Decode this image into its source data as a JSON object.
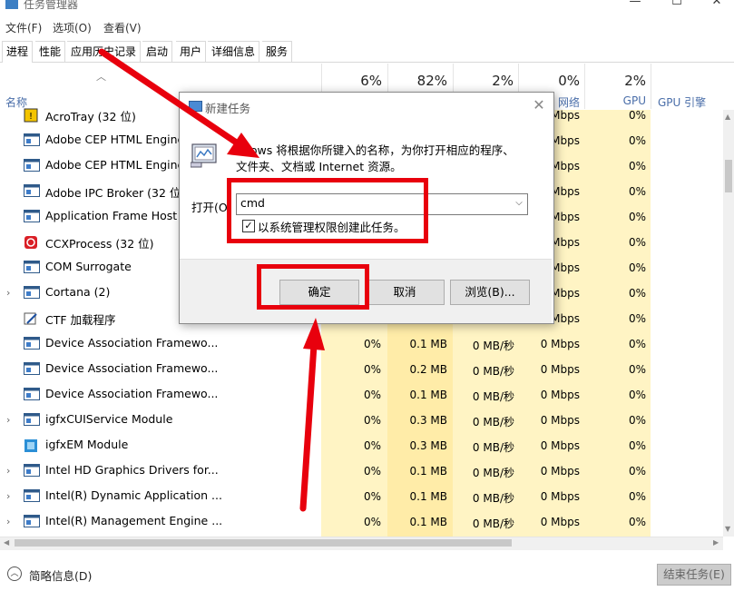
{
  "window": {
    "title": "任务管理器",
    "minimize_glyph": "—",
    "maximize_glyph": "☐",
    "close_glyph": "✕"
  },
  "menu": [
    "文件(F)",
    "选项(O)",
    "查看(V)"
  ],
  "tabs": [
    "进程",
    "性能",
    "应用历史记录",
    "启动",
    "用户",
    "详细信息",
    "服务"
  ],
  "columns": {
    "name": "名称",
    "cpu_pct": "6%",
    "memory_pct": "82%",
    "disk_pct": "2%",
    "network_pct": "0%",
    "network": "网络",
    "gpu_pct": "2%",
    "gpu": "GPU",
    "gpu_engine": "GPU 引擎"
  },
  "rows": [
    {
      "name": "AcroTray (32 位)",
      "expandable": false,
      "icon": "acrotray-icon",
      "cpu": "",
      "mem": "",
      "disk": "",
      "net": "Mbps",
      "gpu": "0%"
    },
    {
      "name": "Adobe CEP HTML Engine",
      "expandable": false,
      "icon": "app-window-icon",
      "cpu": "",
      "mem": "",
      "disk": "",
      "net": "Mbps",
      "gpu": "0%"
    },
    {
      "name": "Adobe CEP HTML Engine",
      "expandable": false,
      "icon": "app-window-icon",
      "cpu": "",
      "mem": "",
      "disk": "",
      "net": "Mbps",
      "gpu": "0%"
    },
    {
      "name": "Adobe IPC Broker (32 位)",
      "expandable": false,
      "icon": "app-window-icon",
      "cpu": "",
      "mem": "",
      "disk": "",
      "net": "Mbps",
      "gpu": "0%"
    },
    {
      "name": "Application Frame Host",
      "expandable": false,
      "icon": "app-window-icon",
      "cpu": "",
      "mem": "",
      "disk": "",
      "net": "Mbps",
      "gpu": "0%"
    },
    {
      "name": "CCXProcess (32 位)",
      "expandable": false,
      "icon": "creative-cloud-icon",
      "cpu": "",
      "mem": "",
      "disk": "",
      "net": "Mbps",
      "gpu": "0%"
    },
    {
      "name": "COM Surrogate",
      "expandable": false,
      "icon": "app-window-icon",
      "cpu": "",
      "mem": "",
      "disk": "",
      "net": "Mbps",
      "gpu": "0%"
    },
    {
      "name": "Cortana (2)",
      "expandable": true,
      "icon": "app-window-icon",
      "cpu": "",
      "mem": "",
      "disk": "",
      "net": "Mbps",
      "gpu": "0%"
    },
    {
      "name": "CTF 加载程序",
      "expandable": false,
      "icon": "ctf-pen-icon",
      "cpu": "",
      "mem": "",
      "disk": "",
      "net": "Mbps",
      "gpu": "0%"
    },
    {
      "name": "Device Association Framewo...",
      "expandable": false,
      "icon": "app-window-icon",
      "cpu": "0%",
      "mem": "0.1 MB",
      "disk": "0 MB/秒",
      "net": "0 Mbps",
      "gpu": "0%"
    },
    {
      "name": "Device Association Framewo...",
      "expandable": false,
      "icon": "app-window-icon",
      "cpu": "0%",
      "mem": "0.2 MB",
      "disk": "0 MB/秒",
      "net": "0 Mbps",
      "gpu": "0%"
    },
    {
      "name": "Device Association Framewo...",
      "expandable": false,
      "icon": "app-window-icon",
      "cpu": "0%",
      "mem": "0.1 MB",
      "disk": "0 MB/秒",
      "net": "0 Mbps",
      "gpu": "0%"
    },
    {
      "name": "igfxCUIService Module",
      "expandable": true,
      "icon": "app-window-icon",
      "cpu": "0%",
      "mem": "0.3 MB",
      "disk": "0 MB/秒",
      "net": "0 Mbps",
      "gpu": "0%"
    },
    {
      "name": "igfxEM Module",
      "expandable": false,
      "icon": "igfx-icon",
      "cpu": "0%",
      "mem": "0.3 MB",
      "disk": "0 MB/秒",
      "net": "0 Mbps",
      "gpu": "0%"
    },
    {
      "name": "Intel HD Graphics Drivers for...",
      "expandable": true,
      "icon": "app-window-icon",
      "cpu": "0%",
      "mem": "0.1 MB",
      "disk": "0 MB/秒",
      "net": "0 Mbps",
      "gpu": "0%"
    },
    {
      "name": "Intel(R) Dynamic Application ...",
      "expandable": true,
      "icon": "app-window-icon",
      "cpu": "0%",
      "mem": "0.1 MB",
      "disk": "0 MB/秒",
      "net": "0 Mbps",
      "gpu": "0%"
    },
    {
      "name": "Intel(R) Management Engine ...",
      "expandable": true,
      "icon": "app-window-icon",
      "cpu": "0%",
      "mem": "0.1 MB",
      "disk": "0 MB/秒",
      "net": "0 Mbps",
      "gpu": "0%"
    }
  ],
  "footer": {
    "fewer_details": "简略信息(D)",
    "end_task": "结束任务(E)"
  },
  "dialog": {
    "title": "新建任务",
    "description_line1": "ndows 将根据你所键入的名称，为你打开相应的程序、",
    "description_line2": "文件夹、文档或 Internet 资源。",
    "open_label": "打开(O",
    "input_value": "cmd",
    "admin_checkbox_label": "以系统管理权限创建此任务。",
    "admin_checked": true,
    "ok": "确定",
    "cancel": "取消",
    "browse": "浏览(B)..."
  },
  "colors": {
    "annotation_red": "#e8000d",
    "column_highlight": "#fff4c4",
    "column_highlight_strong": "#ffeca8",
    "header_label_blue": "#4a6ea9"
  }
}
